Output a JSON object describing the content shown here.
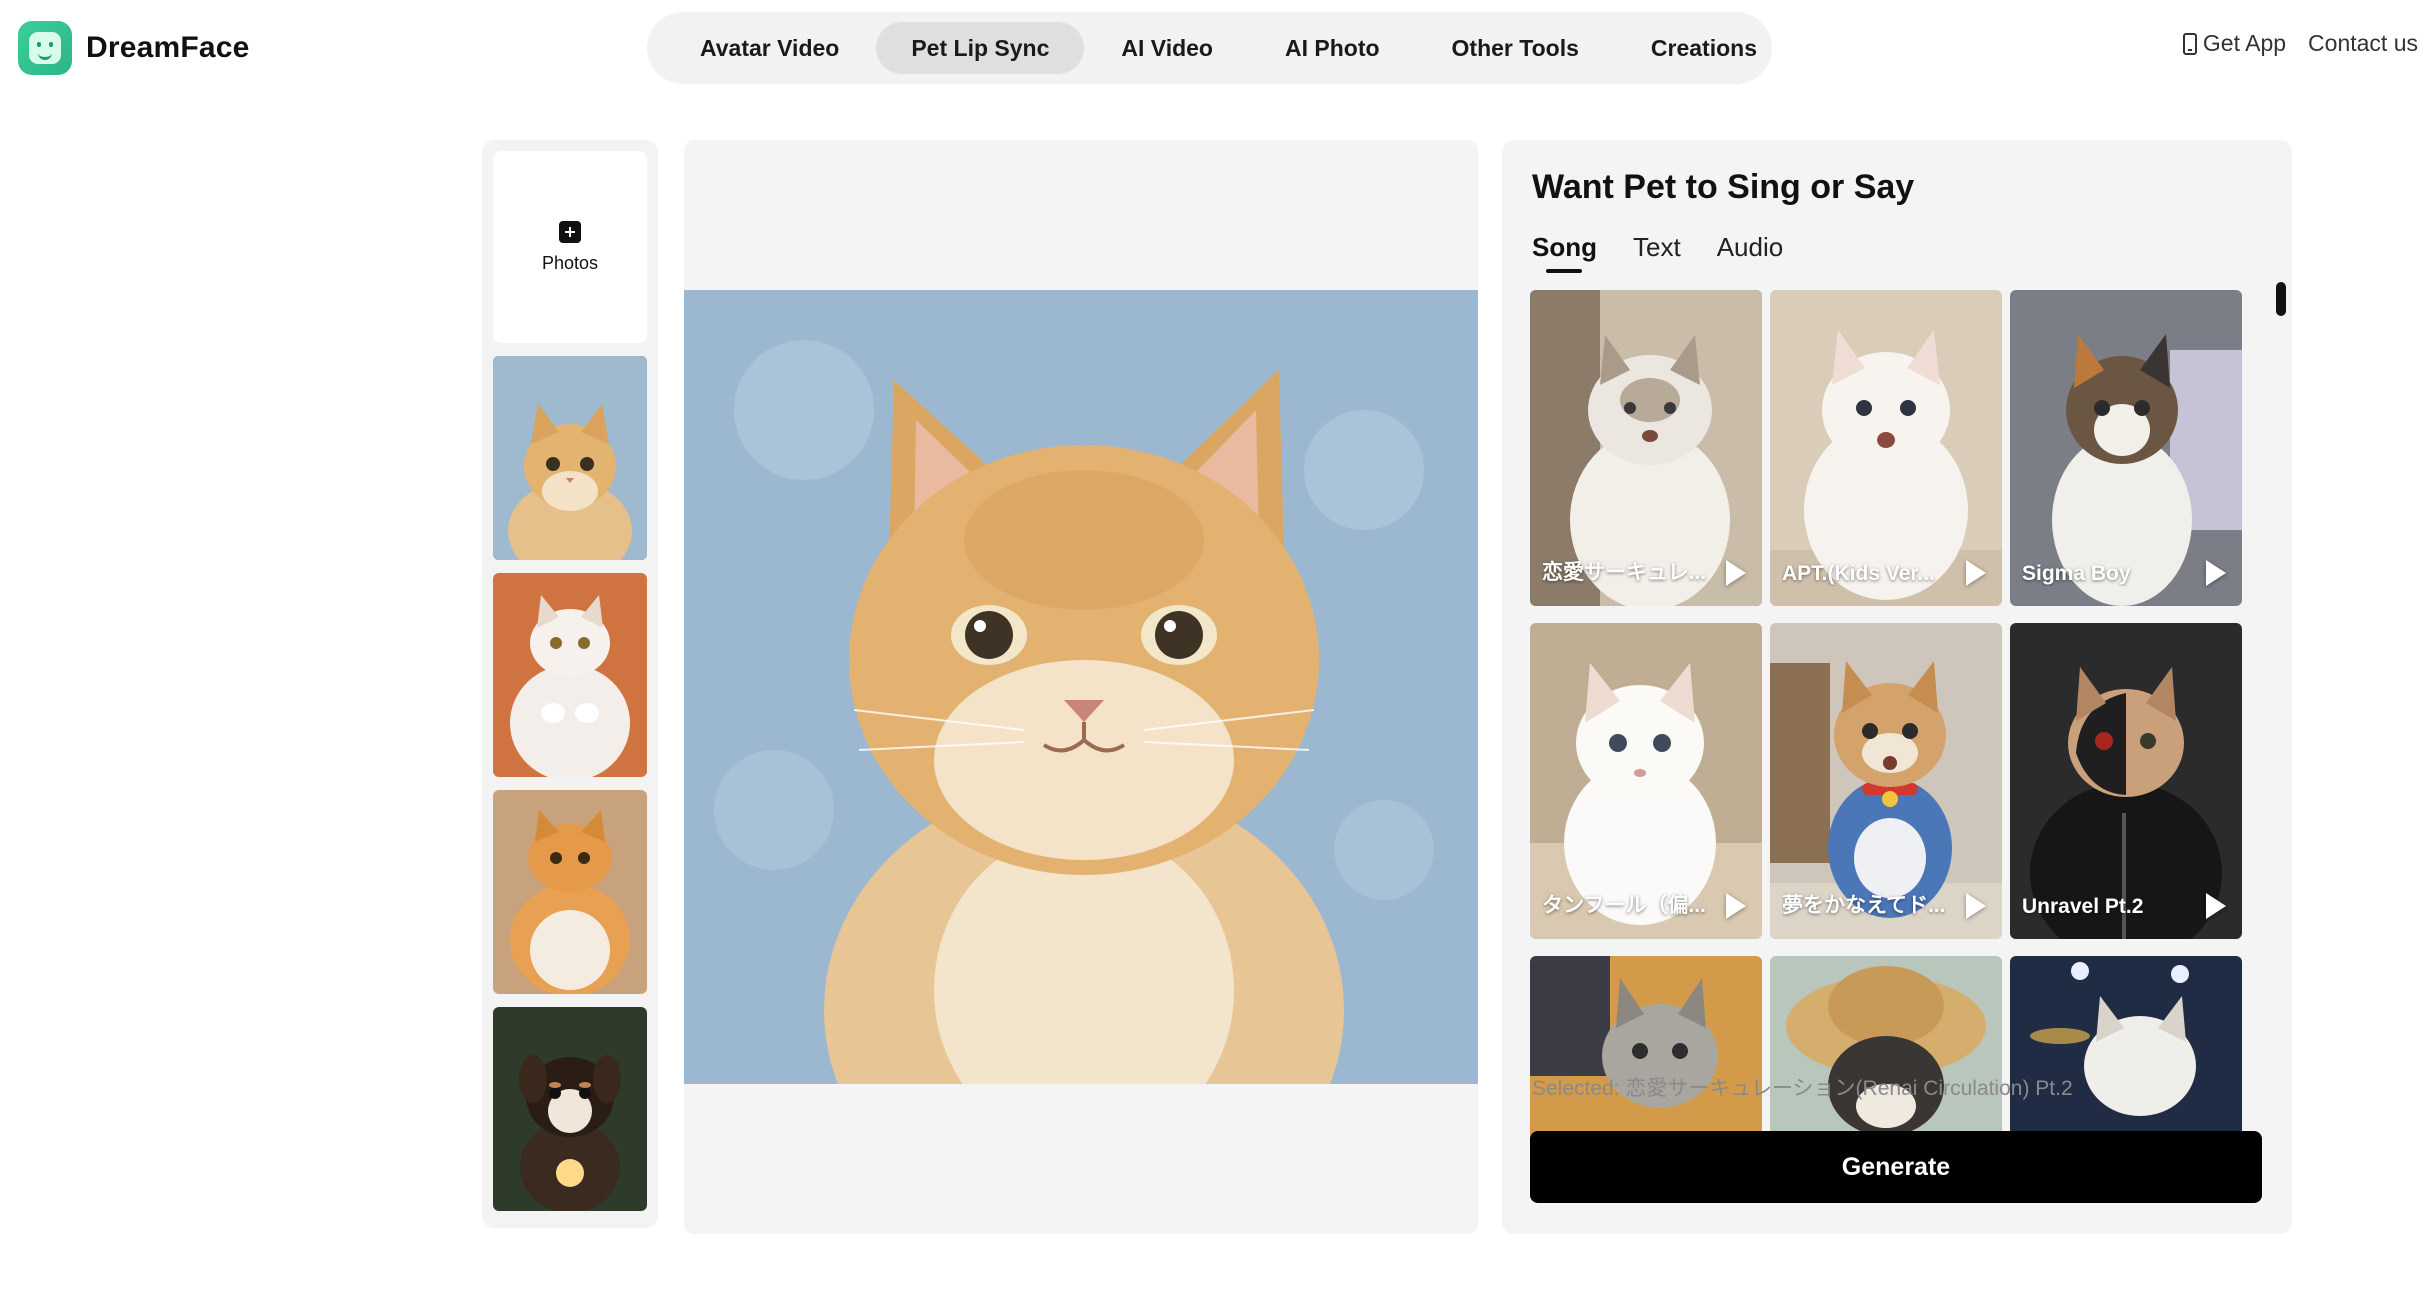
{
  "brand": {
    "name": "DreamFace",
    "logo_icon": "smiley-face-icon",
    "accent": "#2bb585"
  },
  "nav": {
    "items": [
      {
        "label": "Avatar Video",
        "active": false
      },
      {
        "label": "Pet Lip Sync",
        "active": true
      },
      {
        "label": "AI Video",
        "active": false
      },
      {
        "label": "AI Photo",
        "active": false
      },
      {
        "label": "Other Tools",
        "active": false
      },
      {
        "label": "Creations",
        "active": false
      }
    ]
  },
  "header_right": {
    "get_app": "Get App",
    "contact": "Contact us",
    "get_app_icon": "phone-icon"
  },
  "sidebar": {
    "upload_label": "Photos",
    "upload_icon": "plus-square-icon",
    "thumbnails": [
      {
        "subject": "orange cat on blue background",
        "selected": true
      },
      {
        "subject": "white chubby cat on orange background",
        "selected": false
      },
      {
        "subject": "orange tabby chubby cat",
        "selected": false
      },
      {
        "subject": "puppy with light",
        "selected": false
      }
    ]
  },
  "preview": {
    "subject": "orange cat on blue background"
  },
  "panel": {
    "title": "Want Pet to Sing or Say",
    "tabs": [
      {
        "label": "Song",
        "active": true
      },
      {
        "label": "Text",
        "active": false
      },
      {
        "label": "Audio",
        "active": false
      }
    ],
    "songs": [
      {
        "label": "恋愛サーキュレ...",
        "selected": true
      },
      {
        "label": "APT.(Kids Ver...",
        "selected": false
      },
      {
        "label": "Sigma Boy",
        "selected": false
      },
      {
        "label": "タンフール（偏...",
        "selected": false
      },
      {
        "label": "夢をかなえてド...",
        "selected": false
      },
      {
        "label": "Unravel Pt.2",
        "selected": false
      },
      {
        "label": "",
        "selected": false
      },
      {
        "label": "",
        "selected": false
      },
      {
        "label": "",
        "selected": false
      }
    ],
    "selected_text": "Selected: 恋愛サーキュレーション(Renai Circulation) Pt.2",
    "generate_label": "Generate"
  }
}
